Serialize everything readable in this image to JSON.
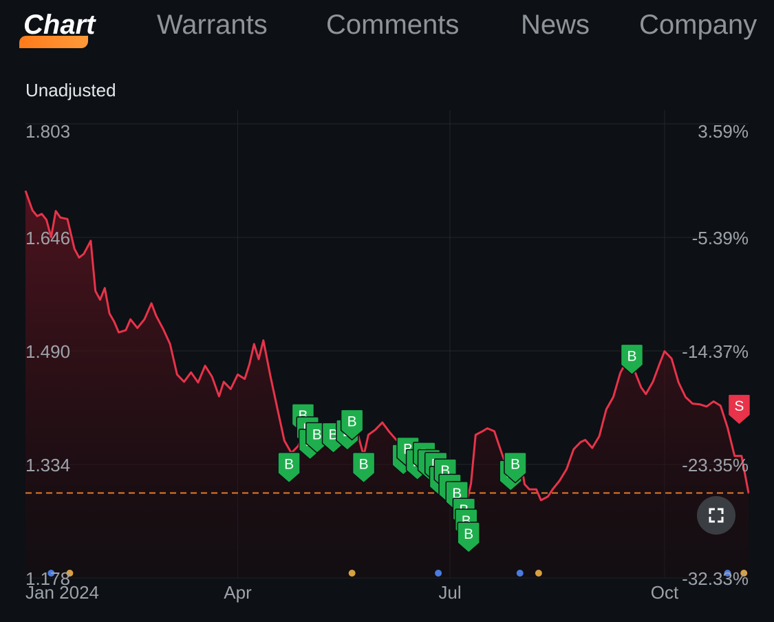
{
  "tabs": [
    {
      "label": "Chart",
      "active": true
    },
    {
      "label": "Warrants",
      "active": false
    },
    {
      "label": "Comments",
      "active": false
    },
    {
      "label": "News",
      "active": false
    },
    {
      "label": "Company",
      "active": false
    }
  ],
  "subtitle": "Unadjusted",
  "colors": {
    "line": "#e8334a",
    "buy_marker": "#1fae4d",
    "sell_marker": "#e8334a",
    "ref_line": "#e87a2a",
    "dot_blue": "#4a7be0",
    "dot_orange": "#d9a040"
  },
  "chart_data": {
    "type": "line",
    "y_left_ticks": [
      "1.803",
      "1.646",
      "1.490",
      "1.334",
      "1.178"
    ],
    "y_right_ticks": [
      "3.59%",
      "-5.39%",
      "-14.37%",
      "-23.35%",
      "-32.33%"
    ],
    "x_ticks": [
      {
        "label": "Jan 2024",
        "date": "2024-01-01"
      },
      {
        "label": "Apr",
        "date": "2024-04-01"
      },
      {
        "label": "Jul",
        "date": "2024-07-01"
      },
      {
        "label": "Oct",
        "date": "2024-10-01"
      }
    ],
    "ylim": [
      1.178,
      1.803
    ],
    "xlim": [
      "2024-01-01",
      "2024-11-06"
    ],
    "reference_value": 1.295,
    "series": [
      {
        "points": [
          [
            "2024-01-01",
            1.711
          ],
          [
            "2024-01-04",
            1.684
          ],
          [
            "2024-01-06",
            1.676
          ],
          [
            "2024-01-08",
            1.679
          ],
          [
            "2024-01-10",
            1.671
          ],
          [
            "2024-01-12",
            1.647
          ],
          [
            "2024-01-14",
            1.683
          ],
          [
            "2024-01-16",
            1.674
          ],
          [
            "2024-01-19",
            1.672
          ],
          [
            "2024-01-22",
            1.631
          ],
          [
            "2024-01-24",
            1.619
          ],
          [
            "2024-01-26",
            1.624
          ],
          [
            "2024-01-29",
            1.642
          ],
          [
            "2024-01-31",
            1.573
          ],
          [
            "2024-02-02",
            1.561
          ],
          [
            "2024-02-04",
            1.577
          ],
          [
            "2024-02-06",
            1.542
          ],
          [
            "2024-02-08",
            1.531
          ],
          [
            "2024-02-10",
            1.516
          ],
          [
            "2024-02-13",
            1.519
          ],
          [
            "2024-02-15",
            1.534
          ],
          [
            "2024-02-18",
            1.522
          ],
          [
            "2024-02-21",
            1.534
          ],
          [
            "2024-02-24",
            1.556
          ],
          [
            "2024-02-26",
            1.539
          ],
          [
            "2024-02-29",
            1.521
          ],
          [
            "2024-03-03",
            1.5
          ],
          [
            "2024-03-06",
            1.458
          ],
          [
            "2024-03-09",
            1.448
          ],
          [
            "2024-03-12",
            1.461
          ],
          [
            "2024-03-15",
            1.447
          ],
          [
            "2024-03-18",
            1.47
          ],
          [
            "2024-03-21",
            1.455
          ],
          [
            "2024-03-24",
            1.428
          ],
          [
            "2024-03-26",
            1.448
          ],
          [
            "2024-03-29",
            1.438
          ],
          [
            "2024-04-01",
            1.458
          ],
          [
            "2024-04-04",
            1.452
          ],
          [
            "2024-04-06",
            1.472
          ],
          [
            "2024-04-08",
            1.5
          ],
          [
            "2024-04-10",
            1.479
          ],
          [
            "2024-04-12",
            1.505
          ],
          [
            "2024-04-15",
            1.456
          ],
          [
            "2024-04-18",
            1.411
          ],
          [
            "2024-04-21",
            1.367
          ],
          [
            "2024-04-24",
            1.35
          ],
          [
            "2024-04-27",
            1.36
          ],
          [
            "2024-04-30",
            1.385
          ],
          [
            "2024-05-03",
            1.375
          ],
          [
            "2024-05-06",
            1.362
          ],
          [
            "2024-05-10",
            1.385
          ],
          [
            "2024-05-13",
            1.37
          ],
          [
            "2024-05-16",
            1.373
          ],
          [
            "2024-05-19",
            1.385
          ],
          [
            "2024-05-22",
            1.382
          ],
          [
            "2024-05-25",
            1.346
          ],
          [
            "2024-05-27",
            1.375
          ],
          [
            "2024-05-30",
            1.382
          ],
          [
            "2024-06-02",
            1.392
          ],
          [
            "2024-06-05",
            1.379
          ],
          [
            "2024-06-08",
            1.368
          ],
          [
            "2024-06-11",
            1.364
          ],
          [
            "2024-06-14",
            1.354
          ],
          [
            "2024-06-17",
            1.337
          ],
          [
            "2024-06-20",
            1.345
          ],
          [
            "2024-06-23",
            1.34
          ],
          [
            "2024-06-26",
            1.332
          ],
          [
            "2024-06-29",
            1.32
          ],
          [
            "2024-07-02",
            1.301
          ],
          [
            "2024-07-05",
            1.29
          ],
          [
            "2024-07-08",
            1.28
          ],
          [
            "2024-07-10",
            1.308
          ],
          [
            "2024-07-12",
            1.375
          ],
          [
            "2024-07-15",
            1.38
          ],
          [
            "2024-07-17",
            1.384
          ],
          [
            "2024-07-20",
            1.38
          ],
          [
            "2024-07-22",
            1.361
          ],
          [
            "2024-07-25",
            1.333
          ],
          [
            "2024-07-27",
            1.325
          ],
          [
            "2024-07-29",
            1.311
          ],
          [
            "2024-07-31",
            1.345
          ],
          [
            "2024-08-02",
            1.307
          ],
          [
            "2024-08-04",
            1.3
          ],
          [
            "2024-08-07",
            1.3
          ],
          [
            "2024-08-09",
            1.285
          ],
          [
            "2024-08-12",
            1.29
          ],
          [
            "2024-08-14",
            1.3
          ],
          [
            "2024-08-17",
            1.312
          ],
          [
            "2024-08-20",
            1.328
          ],
          [
            "2024-08-23",
            1.355
          ],
          [
            "2024-08-26",
            1.365
          ],
          [
            "2024-08-28",
            1.368
          ],
          [
            "2024-08-31",
            1.357
          ],
          [
            "2024-09-03",
            1.373
          ],
          [
            "2024-09-06",
            1.41
          ],
          [
            "2024-09-09",
            1.427
          ],
          [
            "2024-09-12",
            1.46
          ],
          [
            "2024-09-15",
            1.478
          ],
          [
            "2024-09-18",
            1.464
          ],
          [
            "2024-09-21",
            1.44
          ],
          [
            "2024-09-23",
            1.431
          ],
          [
            "2024-09-26",
            1.448
          ],
          [
            "2024-09-29",
            1.474
          ],
          [
            "2024-10-01",
            1.49
          ],
          [
            "2024-10-04",
            1.48
          ],
          [
            "2024-10-07",
            1.447
          ],
          [
            "2024-10-10",
            1.427
          ],
          [
            "2024-10-13",
            1.418
          ],
          [
            "2024-10-16",
            1.417
          ],
          [
            "2024-10-19",
            1.414
          ],
          [
            "2024-10-22",
            1.421
          ],
          [
            "2024-10-25",
            1.415
          ],
          [
            "2024-10-28",
            1.385
          ],
          [
            "2024-10-31",
            1.346
          ],
          [
            "2024-11-03",
            1.346
          ],
          [
            "2024-11-06",
            1.295
          ]
        ]
      }
    ],
    "trade_markers": [
      {
        "date": "2024-04-29",
        "value": 1.376,
        "label": "B"
      },
      {
        "date": "2024-05-01",
        "value": 1.358,
        "label": "B"
      },
      {
        "date": "2024-05-02",
        "value": 1.341,
        "label": "B"
      },
      {
        "date": "2024-05-05",
        "value": 1.35,
        "label": "B"
      },
      {
        "date": "2024-05-12",
        "value": 1.35,
        "label": "B"
      },
      {
        "date": "2024-05-18",
        "value": 1.354,
        "label": "B"
      },
      {
        "date": "2024-05-20",
        "value": 1.368,
        "label": "B"
      },
      {
        "date": "2024-04-23",
        "value": 1.309,
        "label": "B"
      },
      {
        "date": "2024-05-25",
        "value": 1.309,
        "label": "B"
      },
      {
        "date": "2024-06-11",
        "value": 1.32,
        "label": "B"
      },
      {
        "date": "2024-06-13",
        "value": 1.33,
        "label": "B"
      },
      {
        "date": "2024-06-17",
        "value": 1.313,
        "label": "B"
      },
      {
        "date": "2024-06-20",
        "value": 1.323,
        "label": "B"
      },
      {
        "date": "2024-06-22",
        "value": 1.313,
        "label": "B"
      },
      {
        "date": "2024-06-25",
        "value": 1.309,
        "label": "B"
      },
      {
        "date": "2024-06-27",
        "value": 1.29,
        "label": "B"
      },
      {
        "date": "2024-06-29",
        "value": 1.3,
        "label": "B"
      },
      {
        "date": "2024-07-01",
        "value": 1.279,
        "label": "B"
      },
      {
        "date": "2024-07-04",
        "value": 1.269,
        "label": "B"
      },
      {
        "date": "2024-07-07",
        "value": 1.246,
        "label": "B"
      },
      {
        "date": "2024-07-08",
        "value": 1.231,
        "label": "B"
      },
      {
        "date": "2024-07-09",
        "value": 1.213,
        "label": "B"
      },
      {
        "date": "2024-07-27",
        "value": 1.298,
        "label": "B"
      },
      {
        "date": "2024-07-29",
        "value": 1.309,
        "label": "B"
      },
      {
        "date": "2024-09-17",
        "value": 1.458,
        "label": "B"
      },
      {
        "date": "2024-11-02",
        "value": 1.389,
        "label": "S"
      }
    ],
    "event_dots": [
      {
        "date": "2024-01-12",
        "color": "blue"
      },
      {
        "date": "2024-01-20",
        "color": "orange"
      },
      {
        "date": "2024-05-20",
        "color": "orange"
      },
      {
        "date": "2024-06-26",
        "color": "blue"
      },
      {
        "date": "2024-07-31",
        "color": "blue"
      },
      {
        "date": "2024-08-08",
        "color": "orange"
      },
      {
        "date": "2024-10-28",
        "color": "blue"
      },
      {
        "date": "2024-11-04",
        "color": "orange"
      }
    ]
  }
}
